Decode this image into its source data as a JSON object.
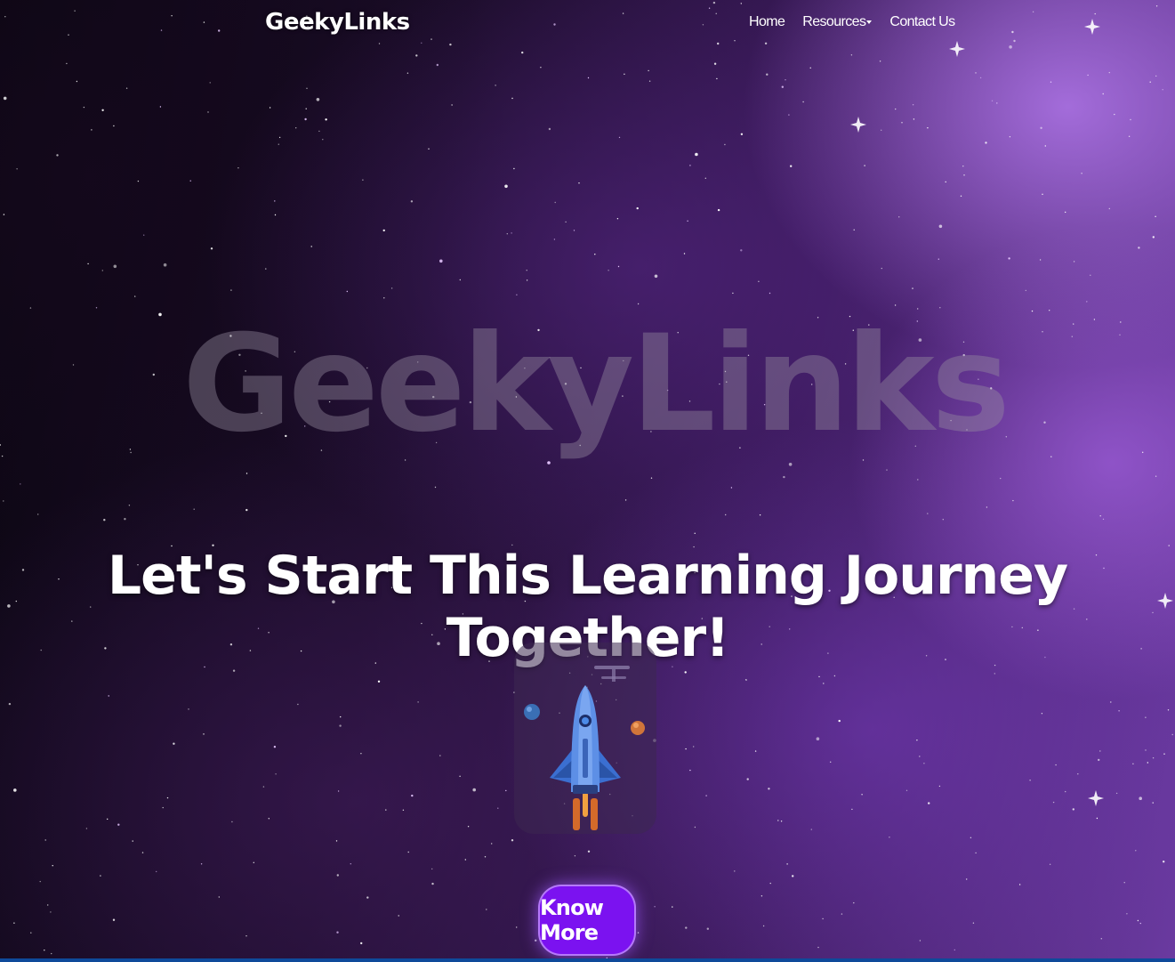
{
  "nav": {
    "brand": "GeekyLinks",
    "items": [
      {
        "label": "Home"
      },
      {
        "label": "Resources",
        "has_dropdown": true
      },
      {
        "label": "Contact Us"
      }
    ]
  },
  "hero": {
    "watermark": "GeekyLinks",
    "headline": "Let's Start This Learning Journey Together!",
    "illustration": "rocket-illustration",
    "cta_label": "Know More"
  },
  "colors": {
    "accent": "#7b12f0",
    "text": "#ffffff"
  }
}
